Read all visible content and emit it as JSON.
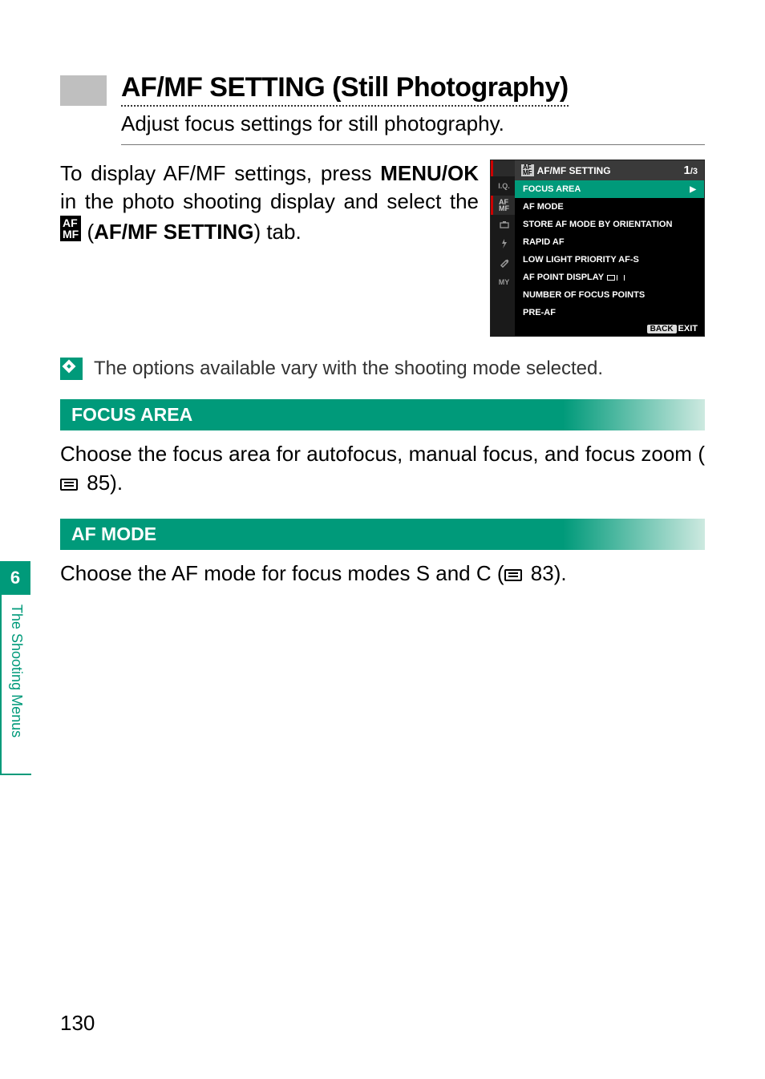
{
  "chapter": {
    "number": "6",
    "label": "The Shooting Menus"
  },
  "heading": {
    "title": "AF/MF SETTING (Still Photography)",
    "subtitle": "Adjust focus settings for still photography."
  },
  "intro": {
    "part1": "To display AF/MF settings, press ",
    "menu_ok": "MENU/OK",
    "part2": " in the photo shooting display and select the ",
    "icon_text": "AF\nMF",
    "part3": " (",
    "tab_label": "AF/MF SETTING",
    "part4": ") tab."
  },
  "camera_menu": {
    "header_icon": "AF\nMF",
    "header_title": "AF/MF SETTING",
    "page_current": "1",
    "page_total": "3",
    "tabs": [
      "I.Q.",
      "AF\nMF",
      "☐",
      "⚡",
      "🔧",
      "MY"
    ],
    "items": [
      "FOCUS AREA",
      "AF MODE",
      "STORE AF MODE BY ORIENTATION",
      "RAPID AF",
      "LOW LIGHT PRIORITY AF-S",
      "AF POINT DISPLAY",
      "NUMBER OF FOCUS POINTS",
      "PRE-AF"
    ],
    "footer_back": "BACK",
    "footer_exit": "EXIT"
  },
  "note": "The options available vary with the shooting mode selected.",
  "sections": {
    "focus_area": {
      "title": "FOCUS AREA",
      "body_a": "Choose the focus area for autofocus, manual focus, and focus zoom (",
      "ref": "85",
      "body_b": ")."
    },
    "af_mode": {
      "title": "AF MODE",
      "body_a": "Choose the AF mode for focus modes ",
      "s": "S",
      "and": " and ",
      "c": "C",
      "body_b": " (",
      "ref": "83",
      "body_c": ")."
    }
  },
  "page_number": "130"
}
